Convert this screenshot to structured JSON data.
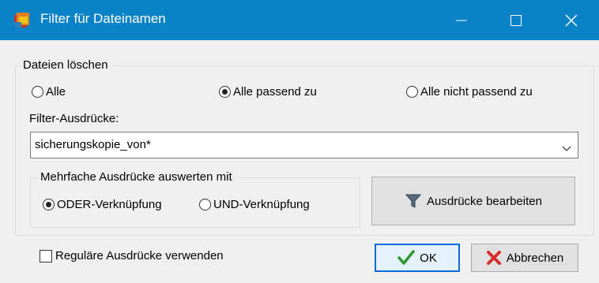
{
  "window": {
    "title": "Filter für Dateinamen",
    "accent_color": "#0a82c8",
    "controls": [
      "minimize-icon",
      "maximize-icon",
      "close-icon"
    ]
  },
  "delete_group": {
    "legend": "Dateien löschen",
    "radios": [
      {
        "label": "Alle",
        "checked": false
      },
      {
        "label": "Alle passend zu",
        "checked": true
      },
      {
        "label": "Alle nicht passend zu",
        "checked": false
      }
    ],
    "filter_label": "Filter-Ausdrücke:",
    "filter_value": "sicherungskopie_von*"
  },
  "eval_group": {
    "legend": "Mehrfache Ausdrücke auswerten mit",
    "radios": [
      {
        "label": "ODER-Verknüpfung",
        "checked": true
      },
      {
        "label": "UND-Verknüpfung",
        "checked": false
      }
    ]
  },
  "edit_button": {
    "label": "Ausdrücke bearbeiten",
    "icon": "funnel-icon"
  },
  "regex_checkbox": {
    "label": "Reguläre Ausdrücke verwenden",
    "checked": false
  },
  "ok_button": {
    "label": "OK",
    "icon": "checkmark-icon"
  },
  "cancel_button": {
    "label": "Abbrechen",
    "icon": "red-x-icon"
  }
}
